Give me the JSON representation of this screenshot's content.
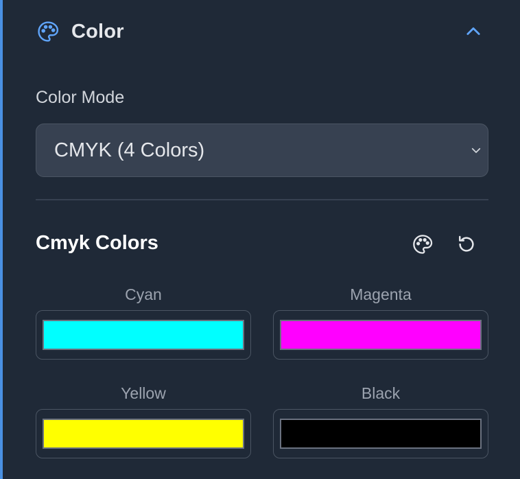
{
  "section": {
    "title": "Color",
    "icon": "palette-icon",
    "collapse_icon": "chevron-up-icon"
  },
  "color_mode": {
    "label": "Color Mode",
    "selected": "CMYK (4 Colors)",
    "dropdown_icon": "chevron-down-icon"
  },
  "cmyk": {
    "title": "Cmyk Colors",
    "tools": [
      "palette-icon",
      "reset-icon"
    ],
    "swatches": [
      {
        "label": "Cyan",
        "color": "#00ffff"
      },
      {
        "label": "Magenta",
        "color": "#ff00ff"
      },
      {
        "label": "Yellow",
        "color": "#ffff00"
      },
      {
        "label": "Black",
        "color": "#000000"
      }
    ]
  },
  "colors": {
    "accent": "#4a90e2",
    "background": "#1f2937",
    "select_bg": "#374151",
    "border": "#4b5563"
  }
}
